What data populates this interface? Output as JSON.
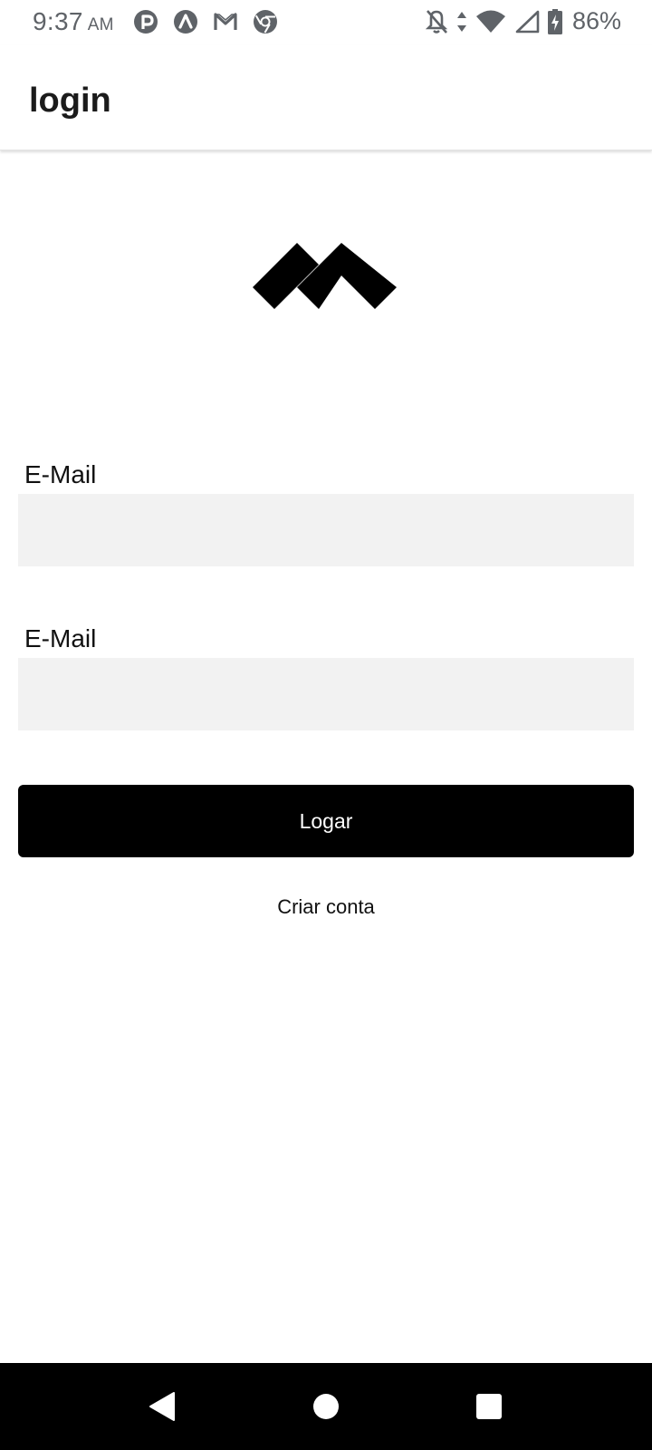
{
  "status_bar": {
    "time": "9:37",
    "ampm": "AM",
    "battery_percent": "86%",
    "notification_icons": [
      "pinterest-icon",
      "arc-icon",
      "gmail-icon",
      "chrome-icon"
    ],
    "system_icons": [
      "notifications-off-icon",
      "data-arrows-icon",
      "wifi-icon",
      "cell-signal-icon",
      "battery-charging-icon"
    ]
  },
  "app_bar": {
    "title": "login"
  },
  "logo": {
    "icon": "brand-logo-icon",
    "color": "#000000"
  },
  "form": {
    "email_label": "E-Mail",
    "email_value": "",
    "second_label": "E-Mail",
    "second_value": "",
    "login_button": "Logar",
    "create_account_link": "Criar conta",
    "input_background": "#f2f2f2",
    "button_background": "#000000",
    "button_text_color": "#ffffff"
  },
  "nav_bar": {
    "buttons": [
      "back-icon",
      "home-icon",
      "recents-icon"
    ]
  }
}
